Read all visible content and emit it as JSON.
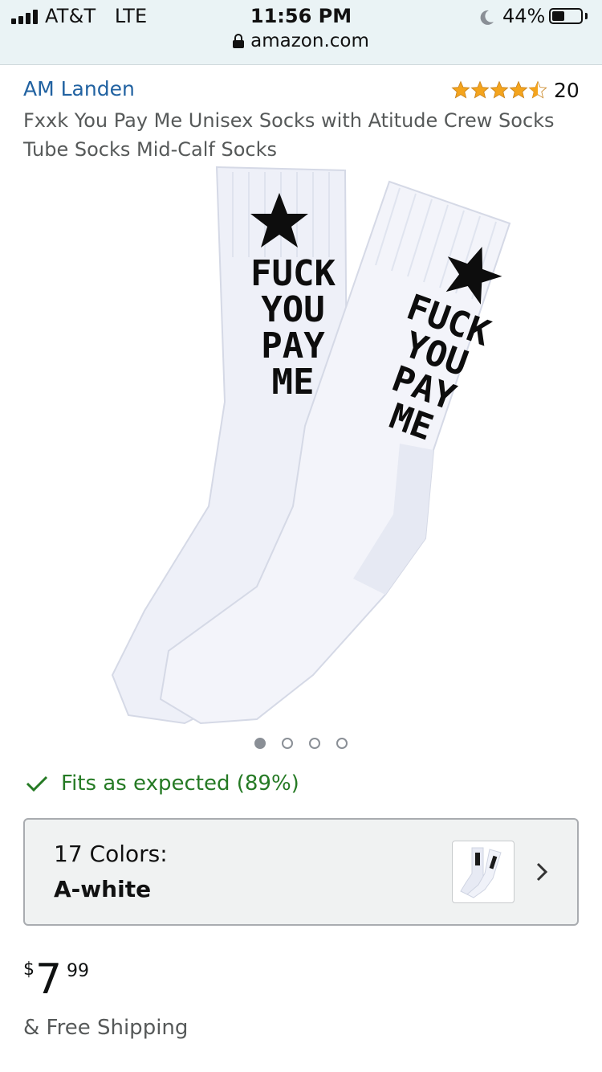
{
  "status_bar": {
    "carrier": "AT&T",
    "network": "LTE",
    "time": "11:56 PM",
    "battery_percent": "44%",
    "battery_level": 0.44,
    "url": "amazon.com"
  },
  "product": {
    "brand": "AM Landen",
    "rating_value": 4.5,
    "rating_count": "20",
    "title": "Fxxk You Pay Me Unisex Socks with Atitude Crew Socks Tube Socks Mid-Calf Socks",
    "image_text": [
      "FUCK",
      "YOU",
      "PAY",
      "ME"
    ],
    "image_count": 4,
    "active_image_index": 0
  },
  "fit": {
    "text": "Fits as expected (89%)",
    "icon": "checkmark-icon",
    "color": "#257a24"
  },
  "colors": {
    "count_label": "17 Colors:",
    "selected": "A-white"
  },
  "price": {
    "symbol": "$",
    "whole": "7",
    "fraction": "99"
  },
  "shipping": "& Free Shipping",
  "theme": {
    "link_color": "#2162a1",
    "star_color": "#f4a41d",
    "status_bar_bg": "#eaf3f5"
  }
}
